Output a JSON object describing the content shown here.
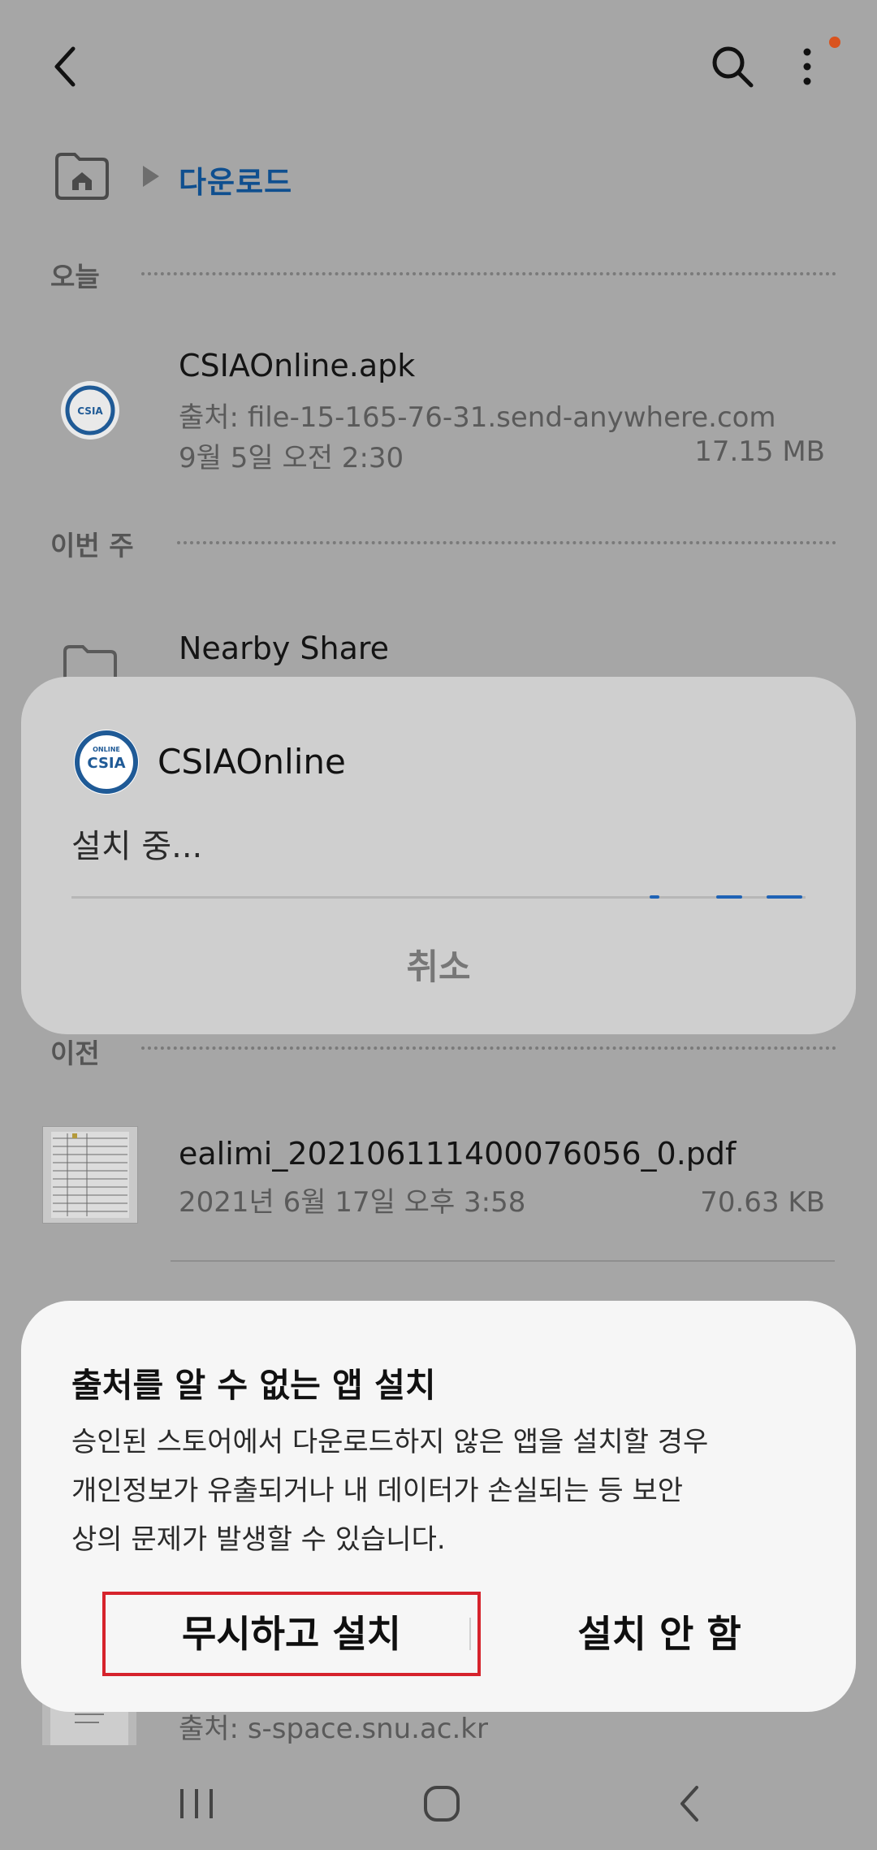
{
  "breadcrumb": {
    "folder": "다운로드"
  },
  "sections": {
    "today": "오늘",
    "this_week": "이번 주",
    "previous": "이전"
  },
  "files": [
    {
      "name": "CSIAOnline.apk",
      "source": "출처: file-15-165-76-31.send-anywhere.com",
      "date": "9월 5일 오전 2:30",
      "size": "17.15 MB"
    },
    {
      "name": "Nearby Share"
    },
    {
      "name": "ealimi_20210611140007605​6_0.pdf",
      "date": "2021년 6월 17일 오후 3:58",
      "size": "70.63 KB"
    },
    {
      "source": "출처: s-space.snu.ac.kr"
    }
  ],
  "progress_dialog": {
    "app_name": "CSIAOnline",
    "logo_top": "ONLINE",
    "logo_main": "CSIA",
    "status": "설치 중...",
    "cancel": "취소"
  },
  "warning_dialog": {
    "title": "출처를 알 수 없는 앱 설치",
    "body_lines": [
      "승인된 스토어에서 다운로드하지 않은 앱을 설치할 경우",
      "개인정보가 유출되거나 내 데이터가 손실되는 등 보안",
      "상의 문제가 발생할 수 있습니다."
    ],
    "install_anyway": "무시하고 설치",
    "dont_install": "설치 안 함"
  },
  "colors": {
    "accent": "#1f63b5",
    "highlight": "#d6232c",
    "notification_dot": "#d9531e"
  }
}
